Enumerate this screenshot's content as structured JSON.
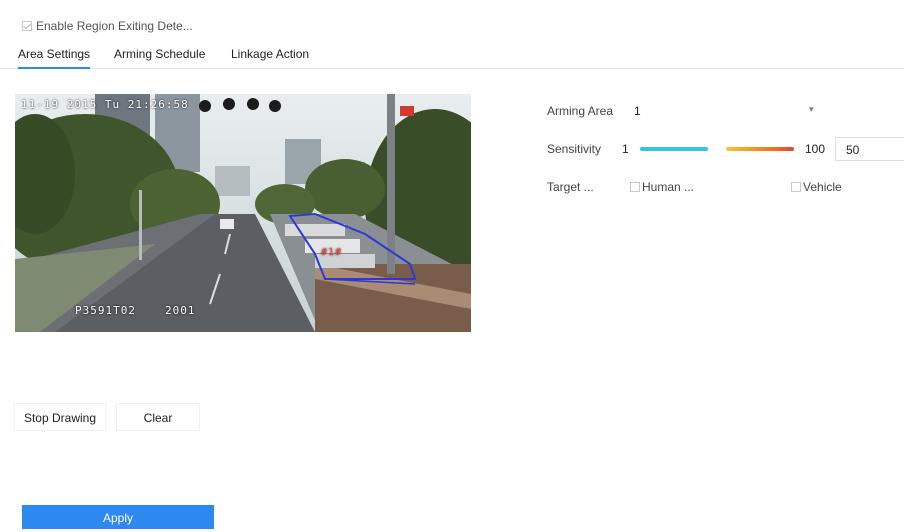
{
  "enable": {
    "label": "Enable Region Exiting Dete...",
    "checked": true
  },
  "tabs": [
    {
      "label": "Area Settings",
      "active": true
    },
    {
      "label": "Arming Schedule",
      "active": false
    },
    {
      "label": "Linkage Action",
      "active": false
    }
  ],
  "video": {
    "timestamp": "11-19 2015 Tu 21:26:58",
    "camera_name": "P3591T02",
    "camera_id": "2001",
    "region_label": "#1#"
  },
  "settings": {
    "arming_area_label": "Arming Area",
    "arming_area_value": "1",
    "sensitivity_label": "Sensitivity",
    "sensitivity_min": "1",
    "sensitivity_max": "100",
    "sensitivity_value": "50",
    "target_label": "Target ...",
    "targets": [
      {
        "label": "Human ...",
        "checked": false
      },
      {
        "label": "Vehicle",
        "checked": false
      }
    ]
  },
  "buttons": {
    "stop_drawing": "Stop Drawing",
    "clear": "Clear",
    "apply": "Apply"
  },
  "colors": {
    "accent": "#2d89ef",
    "sensitivity_low": "#35c1e8",
    "sensitivity_high": "#e9452f",
    "region_outline": "#2b3ad6"
  }
}
